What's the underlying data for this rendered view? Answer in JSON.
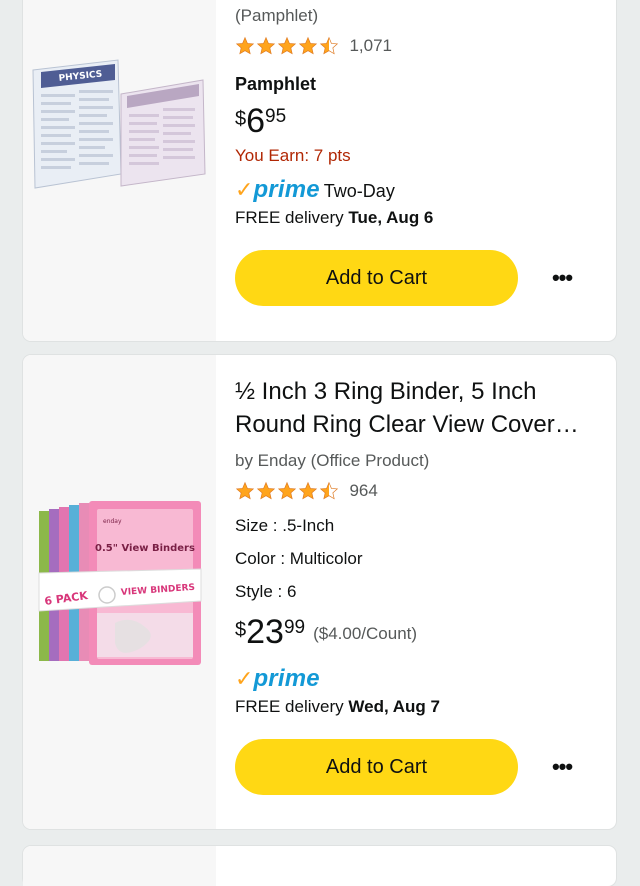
{
  "products": [
    {
      "subtitle": "(Pamphlet)",
      "rating": 4.5,
      "rating_count": "1,071",
      "format": "Pamphlet",
      "price": {
        "currency": "$",
        "whole": "6",
        "fraction": "95"
      },
      "earn": "You Earn: 7 pts",
      "prime": {
        "check": "✓",
        "label": "prime",
        "speed": "Two-Day"
      },
      "delivery": {
        "prefix": "FREE delivery ",
        "date": "Tue, Aug 6"
      },
      "add_to_cart": "Add to Cart",
      "more": "•••",
      "image": {
        "label": "PHYSICS",
        "icon": "laminated-guide-image"
      }
    },
    {
      "title": "½ Inch 3 Ring Binder, 5 Inch Round Ring Clear View Cover…",
      "byline": "by Enday (Office Product)",
      "rating": 4.5,
      "rating_count": "964",
      "attributes": {
        "size": "Size : .5-Inch",
        "color": "Color : Multicolor",
        "style": "Style : 6"
      },
      "price": {
        "currency": "$",
        "whole": "23",
        "fraction": "99"
      },
      "unit_price": "($4.00/Count)",
      "prime": {
        "check": "✓",
        "label": "prime"
      },
      "delivery": {
        "prefix": "FREE delivery ",
        "date": "Wed, Aug 7"
      },
      "add_to_cart": "Add to Cart",
      "more": "•••",
      "image": {
        "label_top": "0.5\" View Binders",
        "label_pack": "6 PACK",
        "label_side": "VIEW BINDERS",
        "brand": "enday",
        "icon": "binders-image"
      }
    }
  ],
  "colors": {
    "cart_button": "#ffd814",
    "star": "#ffa41c",
    "prime_blue": "#1399d6",
    "earn_red": "#b12704"
  }
}
